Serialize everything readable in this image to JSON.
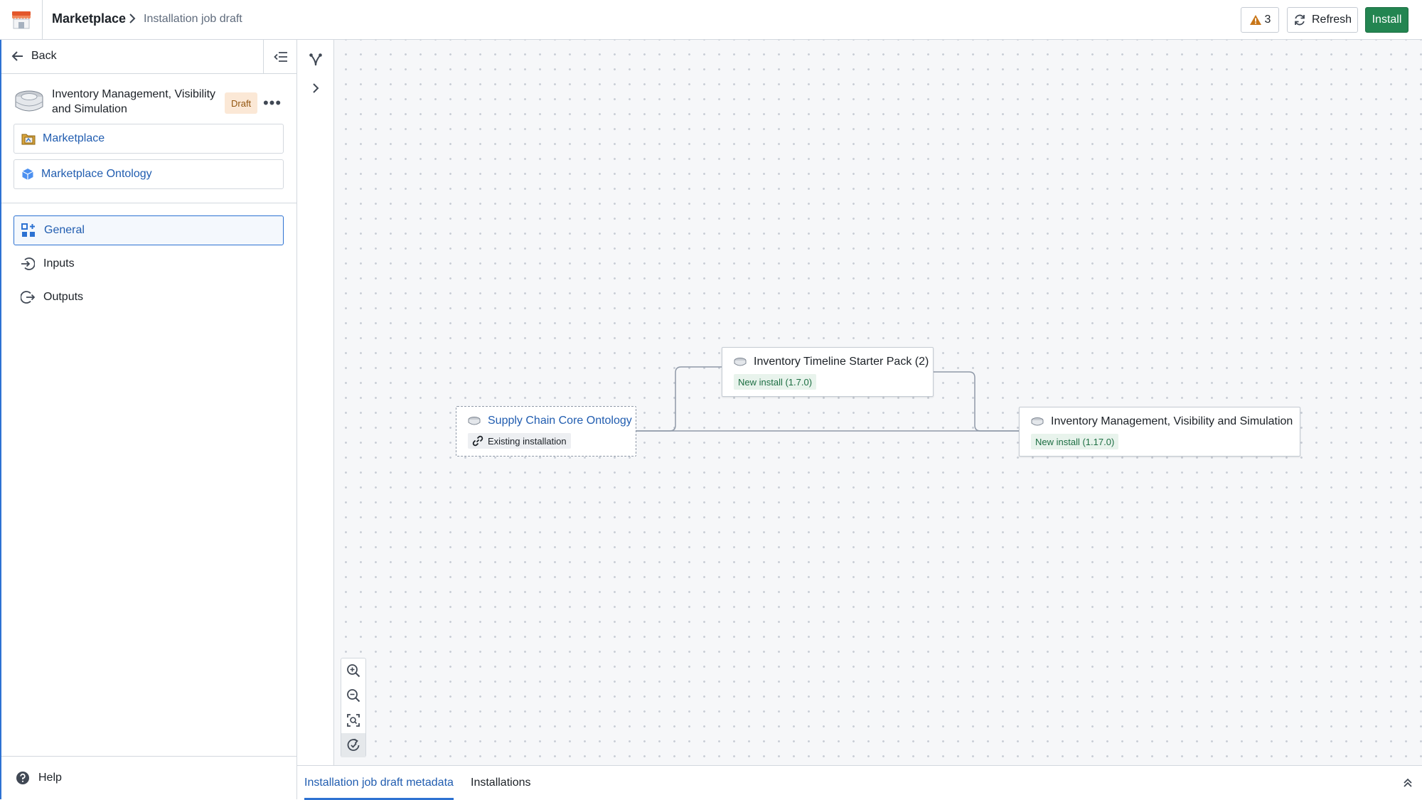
{
  "header": {
    "app_name": "Marketplace",
    "breadcrumb_current": "Installation job draft",
    "warning_count": "3",
    "refresh_label": "Refresh",
    "install_label": "Install",
    "accent_install": "#238551"
  },
  "sidebar": {
    "back_label": "Back",
    "product_name": "Inventory Management, Visibility and Simulation",
    "status_badge": "Draft",
    "links": [
      {
        "label": "Marketplace",
        "icon": "marketplace-folder-icon"
      },
      {
        "label": "Marketplace Ontology",
        "icon": "ontology-cube-icon"
      }
    ],
    "nav": [
      {
        "label": "General",
        "icon": "grid-icon",
        "selected": true
      },
      {
        "label": "Inputs",
        "icon": "log-in-icon",
        "selected": false
      },
      {
        "label": "Outputs",
        "icon": "log-out-icon",
        "selected": false
      }
    ],
    "help_label": "Help"
  },
  "graph": {
    "nodes": [
      {
        "title": "Supply Chain Core Ontology",
        "tag": "Existing installation",
        "kind": "existing"
      },
      {
        "title": "Inventory Timeline Starter Pack (2)",
        "tag": "New install (1.7.0)",
        "kind": "new"
      },
      {
        "title": "Inventory Management, Visibility and Simulation",
        "tag": "New install (1.17.0)",
        "kind": "new"
      }
    ],
    "zoom_tools": [
      "zoom-in-icon",
      "zoom-out-icon",
      "fit-to-screen-icon",
      "auto-layout-icon"
    ]
  },
  "bottom": {
    "tabs": [
      {
        "label": "Installation job draft metadata",
        "selected": true
      },
      {
        "label": "Installations",
        "selected": false
      }
    ]
  }
}
